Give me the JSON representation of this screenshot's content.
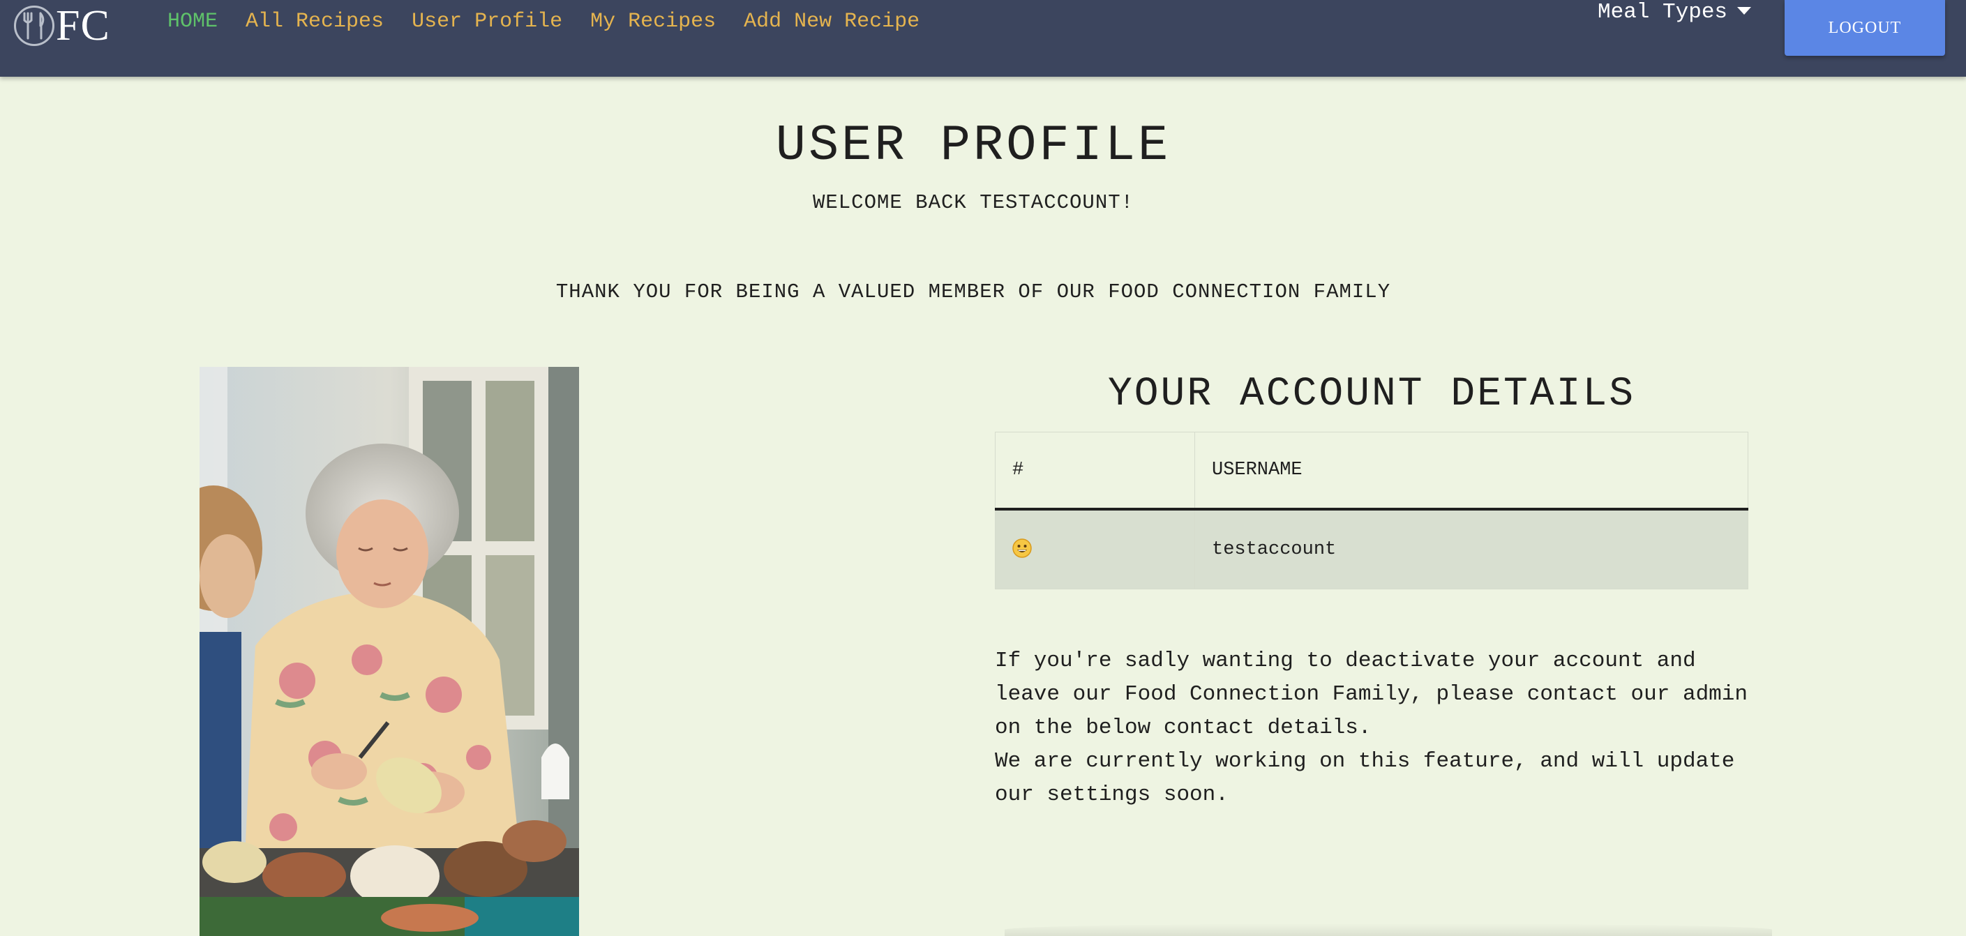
{
  "nav": {
    "logo_text": "FC",
    "logo_icon": "fork-knife-icon",
    "links": [
      {
        "label": "HOME",
        "active": true
      },
      {
        "label": "All Recipes",
        "active": false
      },
      {
        "label": "User Profile",
        "active": false
      },
      {
        "label": "My Recipes",
        "active": false
      },
      {
        "label": "Add New Recipe",
        "active": false
      }
    ],
    "meal_types_label": "Meal Types",
    "logout_label": "LOGOUT"
  },
  "profile": {
    "title": "USER PROFILE",
    "welcome": "WELCOME BACK TESTACCOUNT!",
    "thanks": "THANK YOU FOR BEING A VALUED MEMBER OF OUR FOOD CONNECTION FAMILY"
  },
  "account": {
    "title": "YOUR ACCOUNT DETAILS",
    "columns": [
      "#",
      "USERNAME"
    ],
    "rows": [
      {
        "icon": "grinning-face-emoji",
        "username": "testaccount"
      }
    ]
  },
  "info": {
    "paragraph_1": "If you're sadly wanting to deactivate your account and leave our Food Connection Family, please contact our admin on the below contact details.",
    "paragraph_2": "We are currently working on this feature, and will update our settings soon."
  },
  "colors": {
    "navbar_bg": "#3c455e",
    "nav_link": "#e5b44f",
    "nav_active": "#5fc26a",
    "logout_bg": "#5b86e5",
    "page_bg": "#eef4e2"
  }
}
